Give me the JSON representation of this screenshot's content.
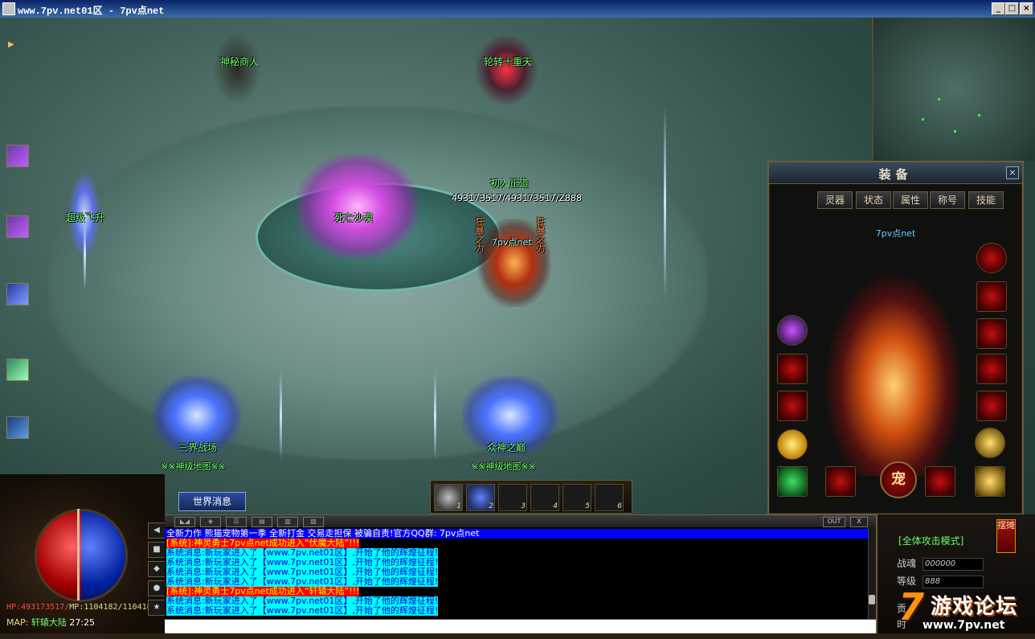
{
  "window": {
    "title": "www.7pv.net01区 - 7pv点net",
    "buttons": {
      "minimize": "_",
      "maximize": "□",
      "close": "×"
    }
  },
  "scene": {
    "npc_labels": [
      "神秘商人",
      "轮转十重天",
      "超级飞升",
      "死亡沙漠",
      "三界战场",
      "众神之巅"
    ],
    "portal_subtitle": "※※神级地图※※",
    "player": {
      "title": "初入正道",
      "hp_text": "493173517/493173517/Z888",
      "name": "7pv点net",
      "side_left": "狂暴之力",
      "side_right": "狂暴之力"
    }
  },
  "equip_panel": {
    "title": "装备",
    "close": "×",
    "tabs": [
      "灵器",
      "状态",
      "属性",
      "称号",
      "技能"
    ],
    "owner": "7pv点net",
    "pet_label": "宠"
  },
  "hotbar": {
    "slots": [
      "1",
      "2",
      "3",
      "4",
      "5",
      "6"
    ]
  },
  "bottom": {
    "world_msg_button": "世界消息",
    "hp_label": "HP:",
    "hp_value": "493173517/",
    "mp_label": "MP:",
    "mp_value": "1104182/1104182",
    "map_label": "MAP:",
    "map_name": "轩辕大陆",
    "coords": "27:25",
    "side_icons": [
      "◀",
      "■",
      "◆",
      "●",
      "★"
    ],
    "chat_buttons": [
      "◣◢",
      "◈",
      "☰",
      "▤",
      "▥",
      "▧"
    ],
    "chat_out": "OUT",
    "chat_close": "X"
  },
  "chat": {
    "lines": [
      {
        "type": "blue",
        "text": "全新力作  熊猫宠物第一季  全新打金  交易走担保  被骗自责!官方QQ群: 7pv点net"
      },
      {
        "type": "red",
        "text": "[系统]:神灵勇士7pv点net成功进入“伏魔大陆”!!!"
      },
      {
        "type": "sys",
        "text": "系统消息:新玩家进入了【www.7pv.net01区】,开始了他的辉煌征程!"
      },
      {
        "type": "sys",
        "text": "系统消息:新玩家进入了【www.7pv.net01区】,开始了他的辉煌征程!"
      },
      {
        "type": "sys",
        "text": "系统消息:新玩家进入了【www.7pv.net01区】,开始了他的辉煌征程!"
      },
      {
        "type": "sys",
        "text": "系统消息:新玩家进入了【www.7pv.net01区】,开始了他的辉煌征程!"
      },
      {
        "type": "red",
        "text": "[系统]:神灵勇士7pv点net成功进入“轩辕大陆”!!!"
      },
      {
        "type": "sys",
        "text": "系统消息:新玩家进入了【www.7pv.net01区】,开始了他的辉煌征程!"
      },
      {
        "type": "sys",
        "text": "系统消息:新玩家进入了【www.7pv.net01区】,开始了他的辉煌征程!"
      }
    ]
  },
  "status_panel": {
    "mode": "[全体攻击模式]",
    "bai_tan": "摆摊",
    "rows": [
      {
        "key": "战魂",
        "value": "000000"
      },
      {
        "key": "等级",
        "value": "888"
      }
    ],
    "extra": [
      "贡",
      "时"
    ]
  },
  "watermark": {
    "digit": "7",
    "text": "游戏论坛",
    "url": "www.7pv.net"
  },
  "colors": {
    "titlebar": "#0a246a",
    "chat_blue": "#0000ff",
    "chat_red": "#ff0000",
    "chat_cyan": "#00ffff",
    "label_green": "#6cff6c"
  }
}
